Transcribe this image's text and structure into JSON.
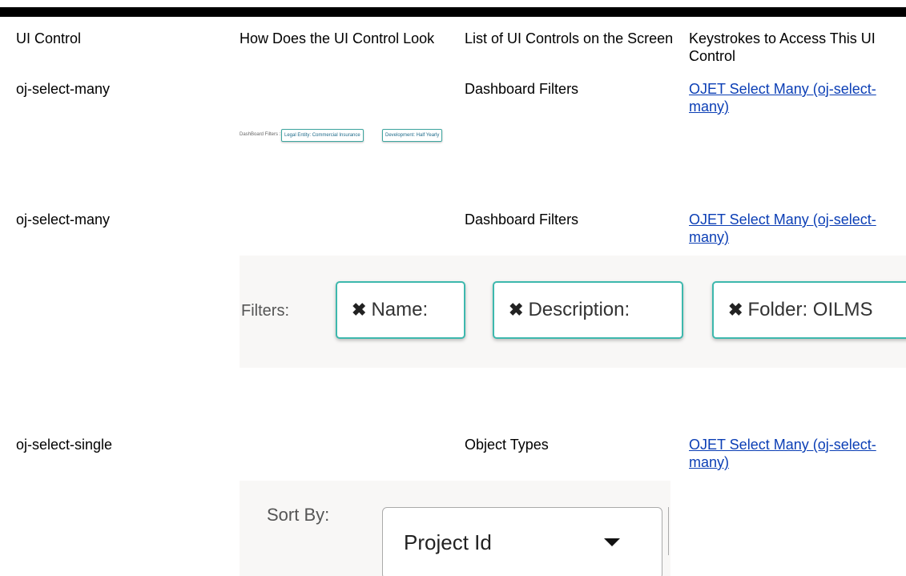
{
  "headers": [
    "UI Control",
    "How Does the UI Control Look",
    "List of UI Controls on the Screen",
    "Keystrokes to Access This UI Control"
  ],
  "rows": [
    {
      "control": "oj-select-many",
      "list": "Dashboard Filters",
      "link": "OJET Select Many (oj-select-many)",
      "image": {
        "label": "DashBoard Filters :",
        "chips": [
          "Legal Entity: Commercial Insurance",
          "Development: Half Yearly"
        ]
      }
    },
    {
      "control": "oj-select-many",
      "list": "Dashboard Filters",
      "link": "OJET Select Many (oj-select-many)",
      "image": {
        "label": "Filters:",
        "chips": [
          "Name:",
          "Description:",
          "Folder: OILMS"
        ],
        "remove_glyph": "✖"
      }
    },
    {
      "control": "oj-select-single",
      "list": "Object Types",
      "link": "OJET Select Many (oj-select-many)",
      "image": {
        "label": "Sort By:",
        "value": "Project Id"
      }
    }
  ],
  "colors": {
    "link": "#0b3eb5",
    "chip_border": "#3db8ad"
  }
}
